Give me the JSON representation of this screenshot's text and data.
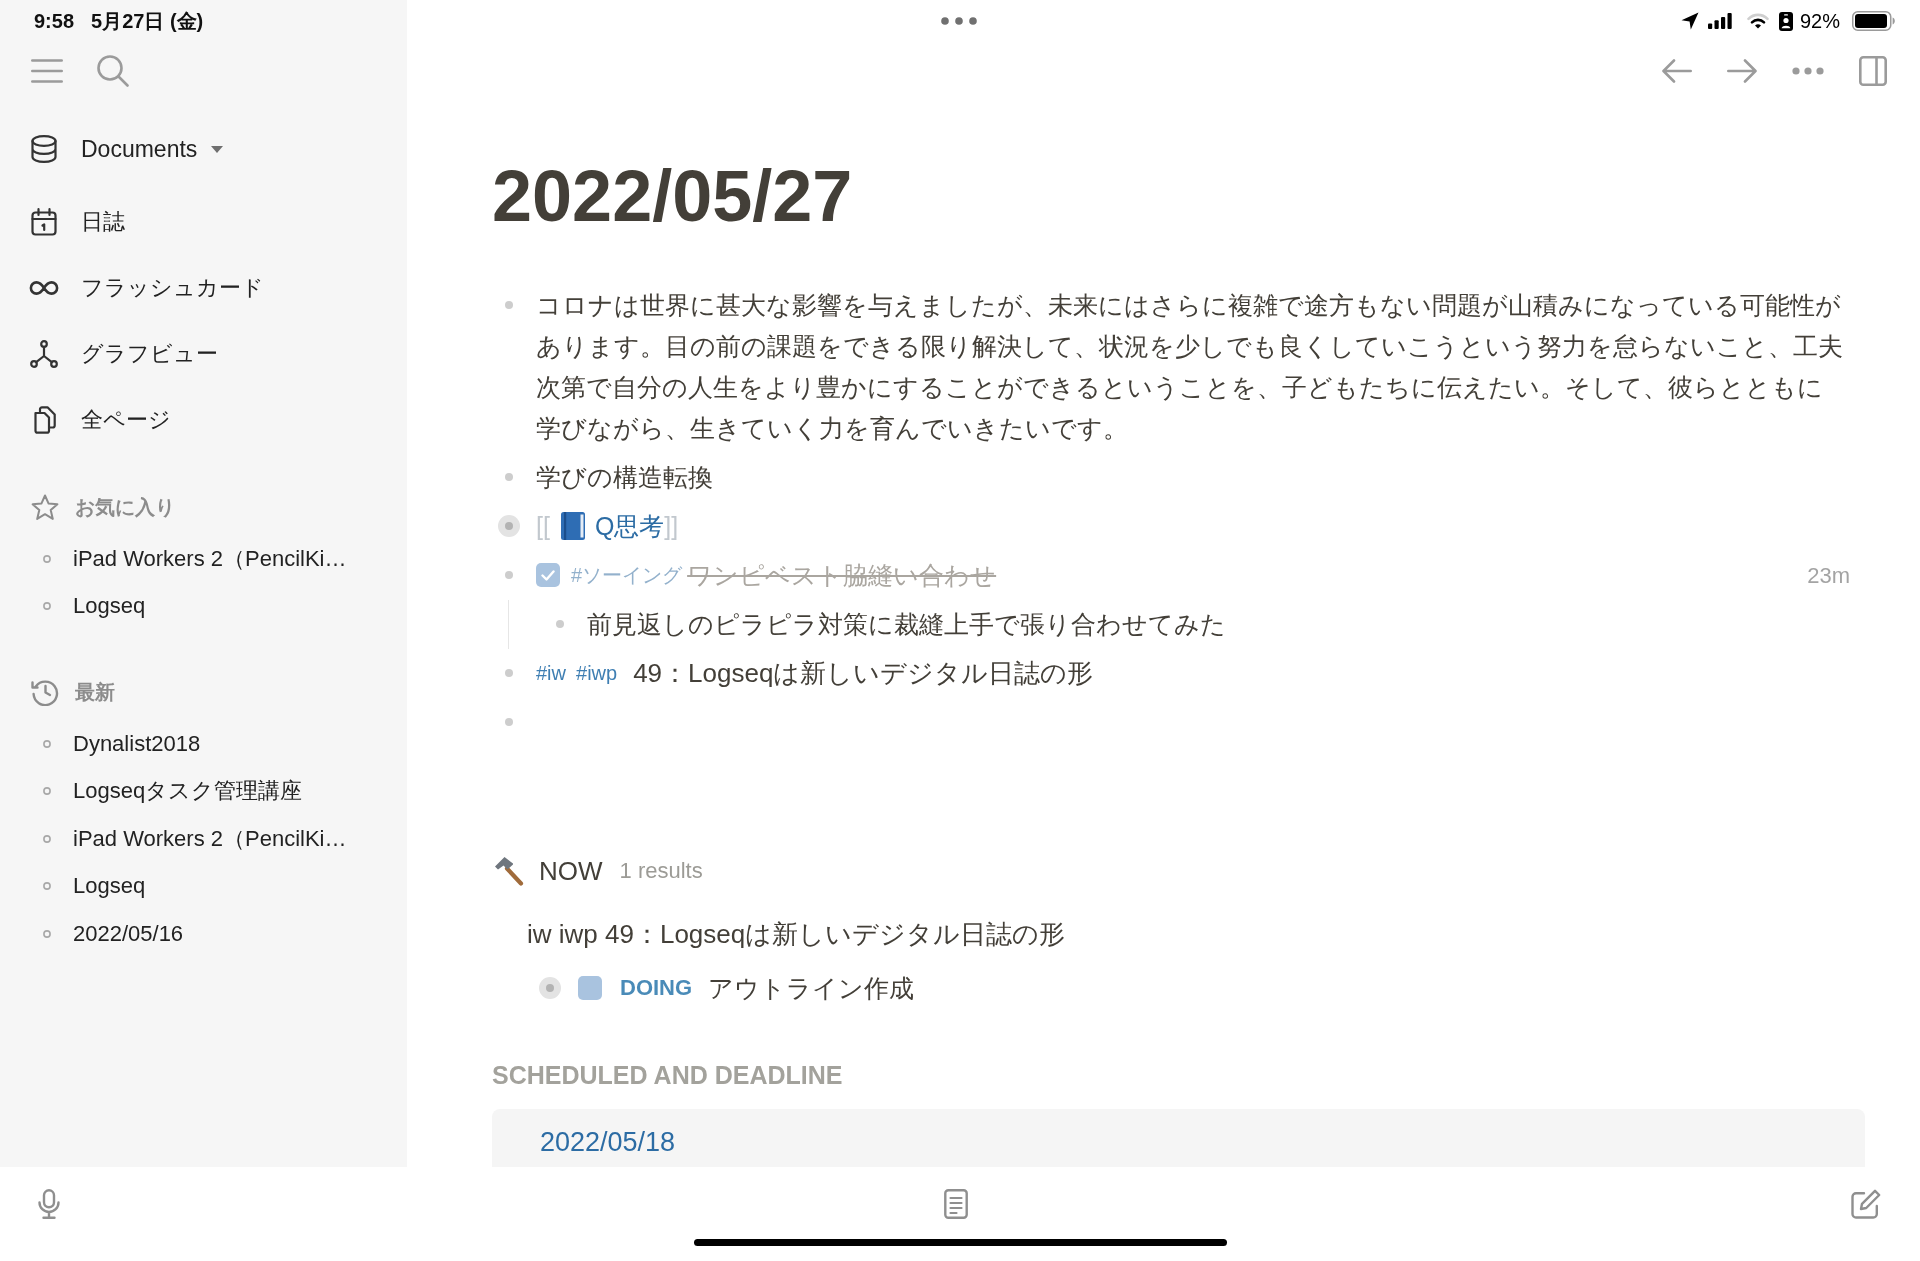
{
  "status_bar": {
    "time": "9:58",
    "date": "5月27日 (金)",
    "battery": "92%"
  },
  "sidebar": {
    "graph": {
      "label": "Documents"
    },
    "nav": [
      {
        "kind": "journals",
        "label": "日誌"
      },
      {
        "kind": "flashcards",
        "label": "フラッシュカード"
      },
      {
        "kind": "graph_view",
        "label": "グラフビュー"
      },
      {
        "kind": "all_pages",
        "label": "全ページ"
      }
    ],
    "favorites": {
      "title": "お気に入り",
      "items": [
        "iPad Workers 2（PencilKi…",
        "Logseq"
      ]
    },
    "recent": {
      "title": "最新",
      "items": [
        "Dynalist2018",
        "Logseqタスク管理講座",
        "iPad Workers 2（PencilKi…",
        "Logseq",
        "2022/05/16"
      ]
    }
  },
  "page": {
    "title": "2022/05/27",
    "blocks": [
      {
        "kind": "text",
        "text": "コロナは世界に甚大な影響を与えましたが、未来にはさらに複雑で途方もない問題が山積みになっている可能性があります。目の前の課題をできる限り解決して、状況を少しでも良くしていこうという努力を怠らないこと、工夫次第で自分の人生をより豊かにすることができるということを、子どもたちに伝えたい。そして、彼らとともに学びながら、生きていく力を育んでいきたいです。",
        "collapsed": false
      },
      {
        "kind": "text",
        "text": "学びの構造転換",
        "collapsed": false
      },
      {
        "kind": "page_ref",
        "open": "[[",
        "title": "Q思考",
        "close": "]]",
        "collapsed": true
      },
      {
        "kind": "todo",
        "checked": true,
        "tags": [
          "#ソーイング"
        ],
        "text": "ワンピベスト脇縫い合わせ",
        "time": "23m",
        "collapsed": false,
        "children": [
          {
            "kind": "text",
            "text": "前見返しのピラピラ対策に裁縫上手で張り合わせてみた",
            "collapsed": false
          }
        ]
      },
      {
        "kind": "tagged",
        "tags": [
          "#iw",
          "#iwp"
        ],
        "text": "49：Logseqは新しいデジタル日誌の形",
        "collapsed": false
      },
      {
        "kind": "empty",
        "collapsed": false
      }
    ]
  },
  "queries": [
    {
      "title": "NOW",
      "count": "1 results",
      "results": [
        {
          "page": "iw iwp 49：Logseqは新しいデジタル日誌の形",
          "blocks": [
            {
              "marker": "DOING",
              "text": "アウトライン作成",
              "checked": false,
              "collapsed": true
            }
          ]
        }
      ]
    }
  ],
  "scheduled": {
    "title": "SCHEDULED AND DEADLINE",
    "items": [
      {
        "page": "2022/05/18"
      }
    ]
  }
}
